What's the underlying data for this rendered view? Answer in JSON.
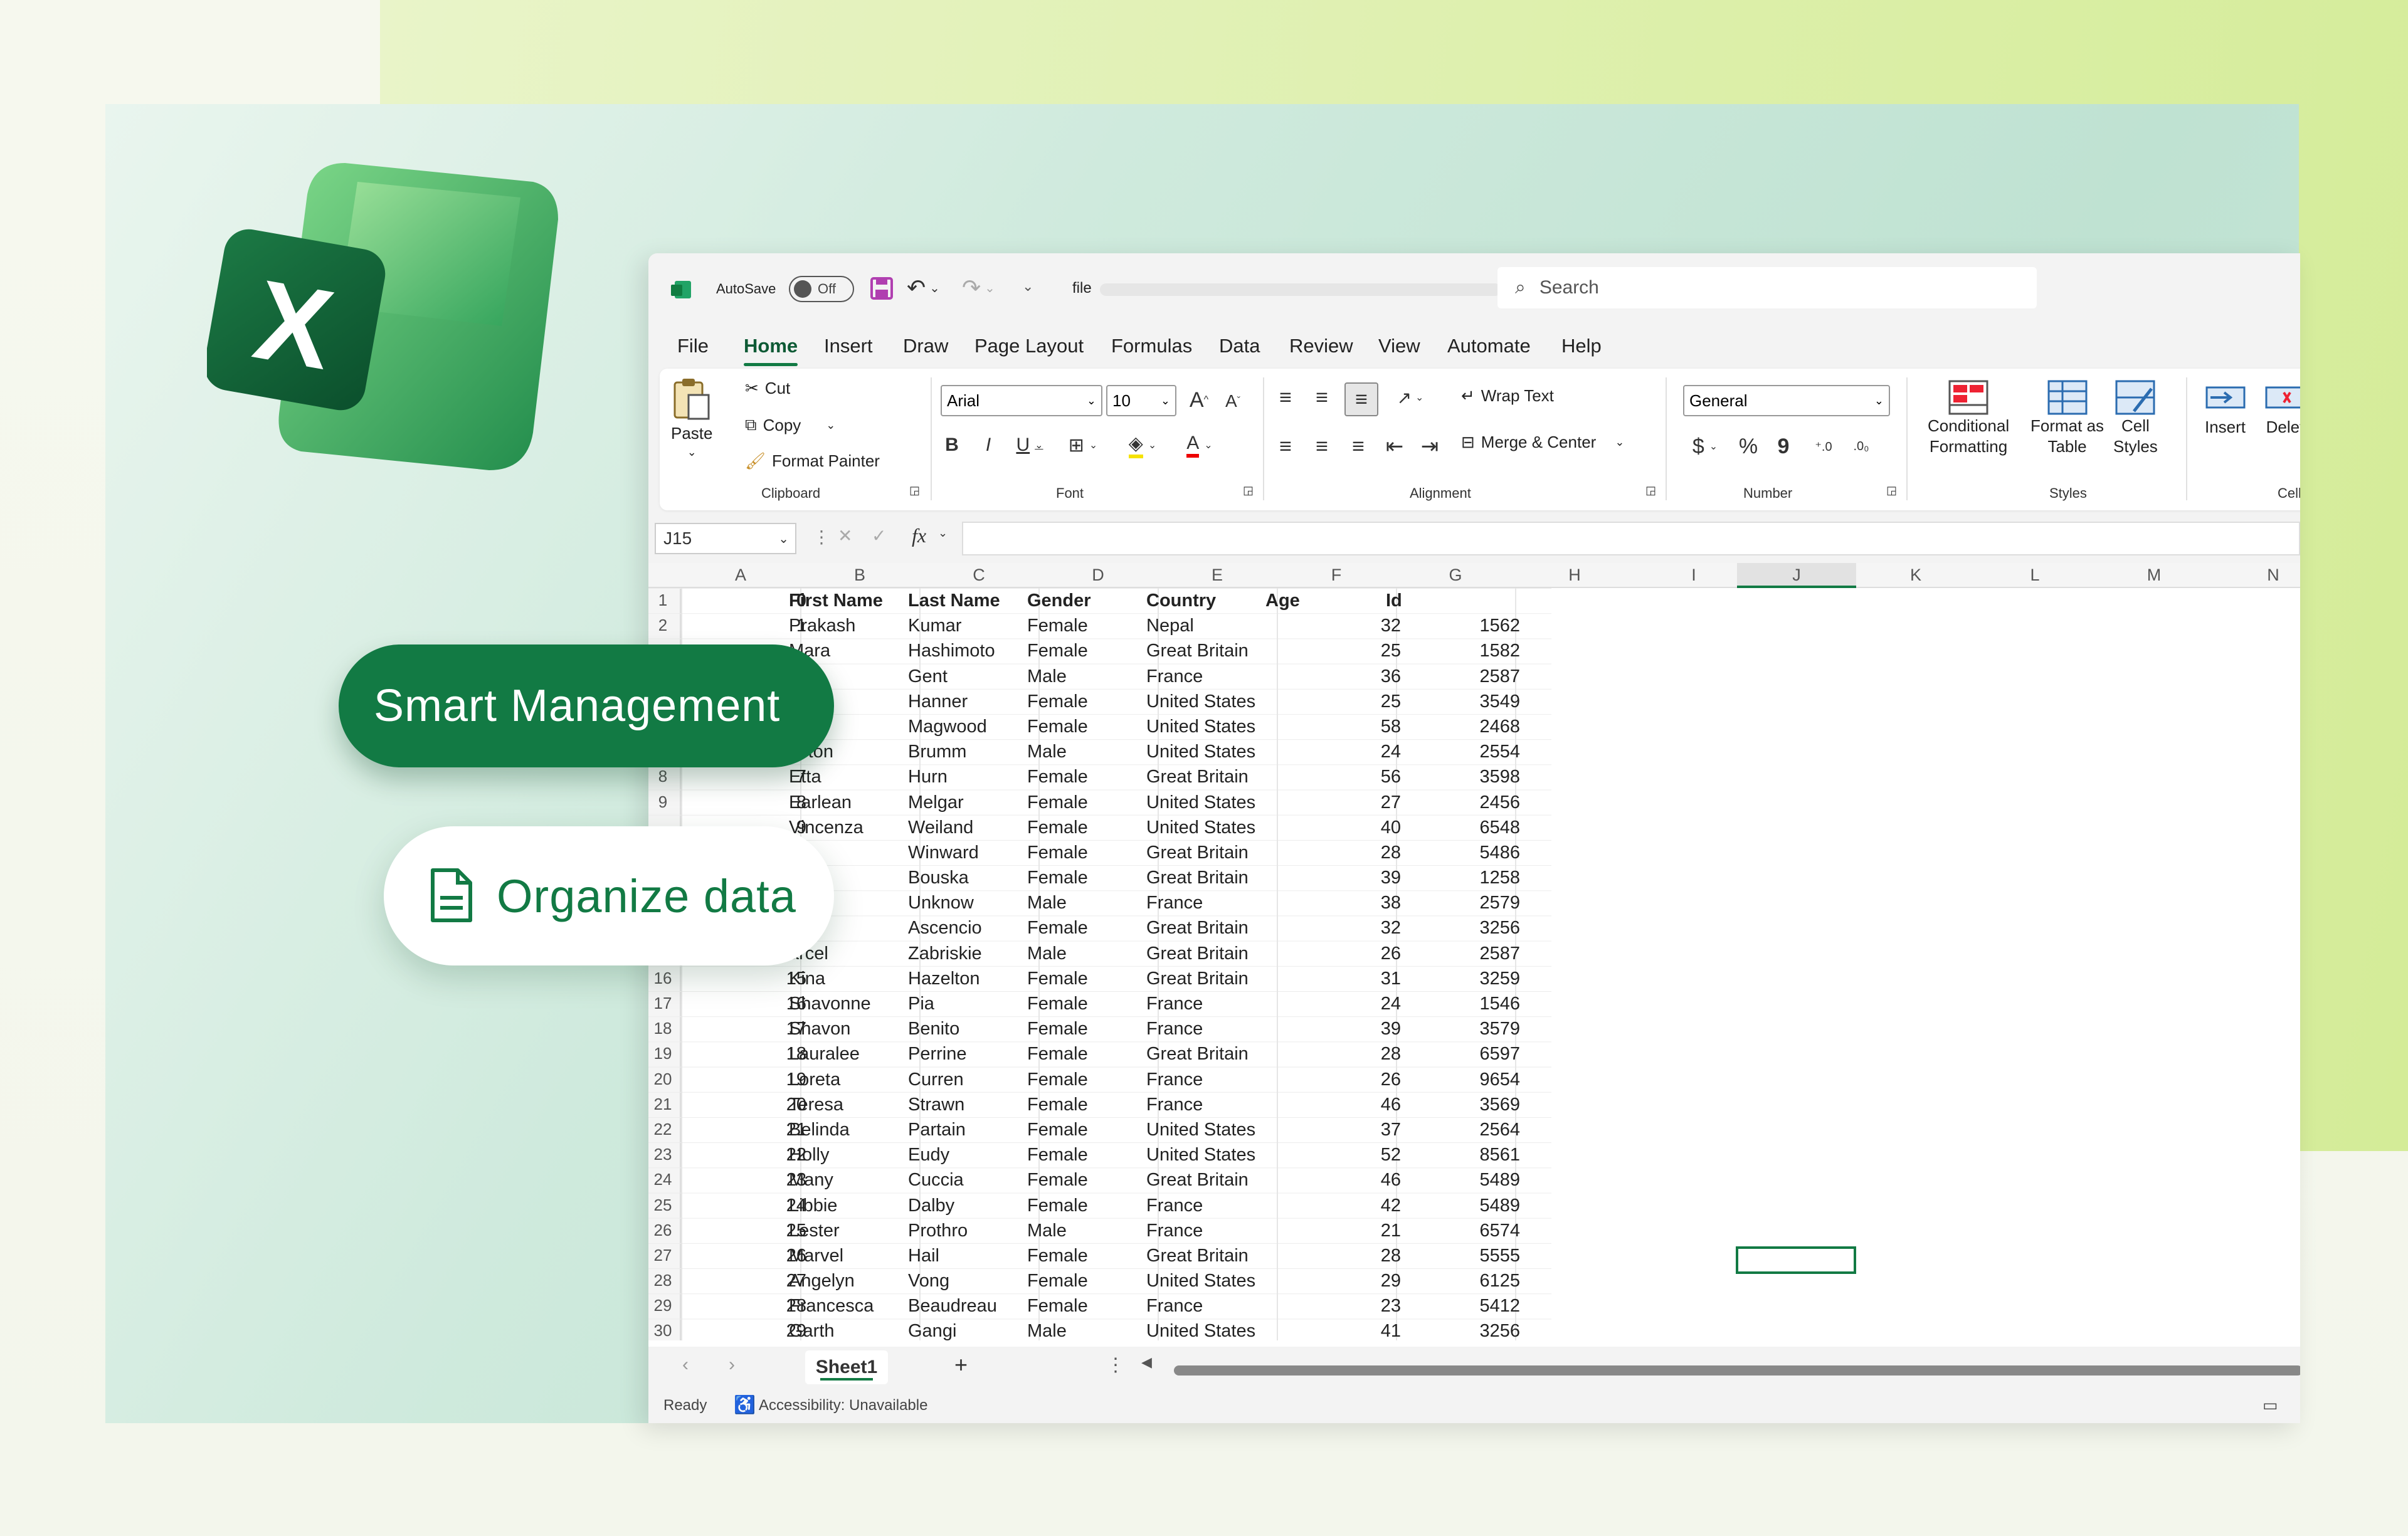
{
  "badges": {
    "smart": "Smart Management",
    "organize": "Organize data"
  },
  "titlebar": {
    "autosave": "AutoSave",
    "toggle": "Off",
    "filename": "file",
    "search_placeholder": "Search"
  },
  "menu": [
    "File",
    "Home",
    "Insert",
    "Draw",
    "Page Layout",
    "Formulas",
    "Data",
    "Review",
    "View",
    "Automate",
    "Help"
  ],
  "ribbon": {
    "paste": "Paste",
    "cut": "Cut",
    "copy": "Copy",
    "format_painter": "Format Painter",
    "clipboard": "Clipboard",
    "font_name": "Arial",
    "font_size": "10",
    "font": "Font",
    "wrap_text": "Wrap Text",
    "merge_center": "Merge & Center",
    "alignment": "Alignment",
    "number_format": "General",
    "number": "Number",
    "conditional_1": "Conditional",
    "conditional_2": "Formatting",
    "format_table_1": "Format as",
    "format_table_2": "Table",
    "cell_styles_1": "Cell",
    "cell_styles_2": "Styles",
    "styles": "Styles",
    "insert": "Insert",
    "delete": "Delet",
    "cells": "Cells"
  },
  "formula_bar": {
    "name_box": "J15",
    "fx": "fx"
  },
  "columns": [
    "A",
    "B",
    "C",
    "D",
    "E",
    "F",
    "G",
    "H",
    "I",
    "J",
    "K",
    "L",
    "M",
    "N"
  ],
  "header_row": {
    "n": "1",
    "a": "0",
    "b": "First Name",
    "c": "Last Name",
    "d": "Gender",
    "e": "Country",
    "f": "Age",
    "g": "Id"
  },
  "rows": [
    {
      "n": "2",
      "a": "1",
      "b": "Prakash",
      "c": "Kumar",
      "d": "Female",
      "e": "Nepal",
      "f": "32",
      "g": "1562"
    },
    {
      "n": "",
      "a": "",
      "b": "Mara",
      "c": "Hashimoto",
      "d": "Female",
      "e": "Great Britain",
      "f": "25",
      "g": "1582"
    },
    {
      "n": "",
      "a": "",
      "b": "p",
      "c": "Gent",
      "d": "Male",
      "e": "France",
      "f": "36",
      "g": "2587"
    },
    {
      "n": "",
      "a": "",
      "b": "een",
      "c": "Hanner",
      "d": "Female",
      "e": "United States",
      "f": "25",
      "g": "3549"
    },
    {
      "n": "",
      "a": "",
      "b": "da",
      "c": "Magwood",
      "d": "Female",
      "e": "United States",
      "f": "58",
      "g": "2468"
    },
    {
      "n": "",
      "a": "",
      "b": "aston",
      "c": "Brumm",
      "d": "Male",
      "e": "United States",
      "f": "24",
      "g": "2554"
    },
    {
      "n": "8",
      "a": "7",
      "b": "Etta",
      "c": "Hurn",
      "d": "Female",
      "e": "Great Britain",
      "f": "56",
      "g": "3598"
    },
    {
      "n": "9",
      "a": "8",
      "b": "Earlean",
      "c": "Melgar",
      "d": "Female",
      "e": "United States",
      "f": "27",
      "g": "2456"
    },
    {
      "n": "",
      "a": "9",
      "b": "Vincenza",
      "c": "Weiland",
      "d": "Female",
      "e": "United States",
      "f": "40",
      "g": "6548"
    },
    {
      "n": "",
      "a": "",
      "b": "on",
      "c": "Winward",
      "d": "Female",
      "e": "Great Britain",
      "f": "28",
      "g": "5486"
    },
    {
      "n": "",
      "a": "",
      "b": "ia",
      "c": "Bouska",
      "d": "Female",
      "e": "Great Britain",
      "f": "39",
      "g": "1258"
    },
    {
      "n": "",
      "a": "",
      "b": "dyn",
      "c": "Unknow",
      "d": "Male",
      "e": "France",
      "f": "38",
      "g": "2579"
    },
    {
      "n": "",
      "a": "",
      "b": "ron",
      "c": "Ascencio",
      "d": "Female",
      "e": "Great Britain",
      "f": "32",
      "g": "3256"
    },
    {
      "n": "",
      "a": "",
      "b": "arcel",
      "c": "Zabriskie",
      "d": "Male",
      "e": "Great Britain",
      "f": "26",
      "g": "2587"
    },
    {
      "n": "16",
      "a": "15",
      "b": "Kina",
      "c": "Hazelton",
      "d": "Female",
      "e": "Great Britain",
      "f": "31",
      "g": "3259"
    },
    {
      "n": "17",
      "a": "16",
      "b": "Shavonne",
      "c": "Pia",
      "d": "Female",
      "e": "France",
      "f": "24",
      "g": "1546"
    },
    {
      "n": "18",
      "a": "17",
      "b": "Shavon",
      "c": "Benito",
      "d": "Female",
      "e": "France",
      "f": "39",
      "g": "3579"
    },
    {
      "n": "19",
      "a": "18",
      "b": "Lauralee",
      "c": "Perrine",
      "d": "Female",
      "e": "Great Britain",
      "f": "28",
      "g": "6597"
    },
    {
      "n": "20",
      "a": "19",
      "b": "Loreta",
      "c": "Curren",
      "d": "Female",
      "e": "France",
      "f": "26",
      "g": "9654"
    },
    {
      "n": "21",
      "a": "20",
      "b": "Teresa",
      "c": "Strawn",
      "d": "Female",
      "e": "France",
      "f": "46",
      "g": "3569"
    },
    {
      "n": "22",
      "a": "21",
      "b": "Belinda",
      "c": "Partain",
      "d": "Female",
      "e": "United States",
      "f": "37",
      "g": "2564"
    },
    {
      "n": "23",
      "a": "22",
      "b": "Holly",
      "c": "Eudy",
      "d": "Female",
      "e": "United States",
      "f": "52",
      "g": "8561"
    },
    {
      "n": "24",
      "a": "23",
      "b": "Many",
      "c": "Cuccia",
      "d": "Female",
      "e": "Great Britain",
      "f": "46",
      "g": "5489"
    },
    {
      "n": "25",
      "a": "24",
      "b": "Libbie",
      "c": "Dalby",
      "d": "Female",
      "e": "France",
      "f": "42",
      "g": "5489"
    },
    {
      "n": "26",
      "a": "25",
      "b": "Lester",
      "c": "Prothro",
      "d": "Male",
      "e": "France",
      "f": "21",
      "g": "6574"
    },
    {
      "n": "27",
      "a": "26",
      "b": "Marvel",
      "c": "Hail",
      "d": "Female",
      "e": "Great Britain",
      "f": "28",
      "g": "5555"
    },
    {
      "n": "28",
      "a": "27",
      "b": "Angelyn",
      "c": "Vong",
      "d": "Female",
      "e": "United States",
      "f": "29",
      "g": "6125"
    },
    {
      "n": "29",
      "a": "28",
      "b": "Francesca",
      "c": "Beaudreau",
      "d": "Female",
      "e": "France",
      "f": "23",
      "g": "5412"
    },
    {
      "n": "30",
      "a": "29",
      "b": "Garth",
      "c": "Gangi",
      "d": "Male",
      "e": "United States",
      "f": "41",
      "g": "3256"
    }
  ],
  "sheet": {
    "tab": "Sheet1",
    "add": "+"
  },
  "status": {
    "ready": "Ready",
    "accessibility": "Accessibility: Unavailable"
  },
  "colors": {
    "excel_green": "#127a44",
    "accent": "#0e5a35"
  }
}
